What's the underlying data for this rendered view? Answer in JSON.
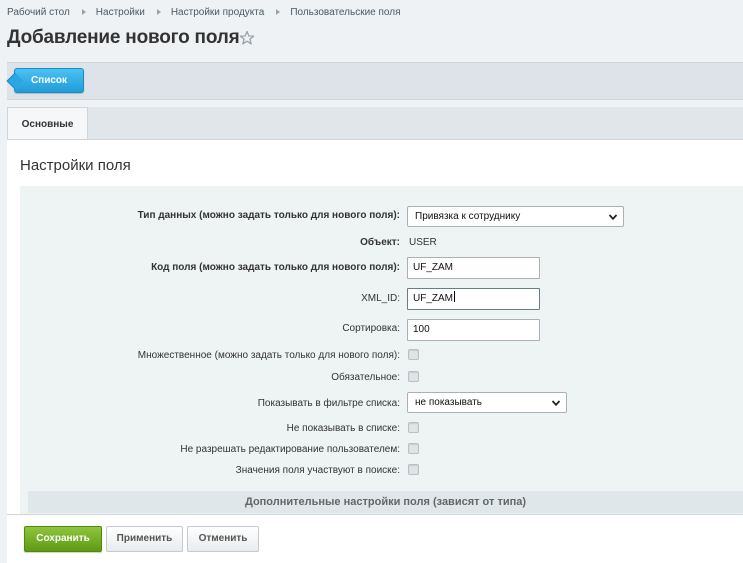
{
  "breadcrumbs": [
    "Рабочий стол",
    "Настройки",
    "Настройки продукта",
    "Пользовательские поля"
  ],
  "title": "Добавление нового поля",
  "toolbar": {
    "list_button": "Список"
  },
  "tabs": [
    {
      "label": "Основные",
      "active": true
    }
  ],
  "section_title": "Настройки поля",
  "form": {
    "data_type": {
      "label": "Тип данных (можно задать только для нового поля):",
      "value": "Привязка к сотруднику"
    },
    "object": {
      "label": "Объект:",
      "value": "USER"
    },
    "field_code": {
      "label": "Код поля (можно задать только для нового поля):",
      "value": "UF_ZAM"
    },
    "xml_id": {
      "label": "XML_ID:",
      "value": "UF_ZAM"
    },
    "sort": {
      "label": "Сортировка:",
      "value": "100"
    },
    "multiple": {
      "label": "Множественное (можно задать только для нового поля):",
      "checked": false
    },
    "required": {
      "label": "Обязательное:",
      "checked": false
    },
    "show_filter": {
      "label": "Показывать в фильтре списка:",
      "value": "не показывать"
    },
    "hide_in_list": {
      "label": "Не показывать в списке:",
      "checked": false
    },
    "no_user_edit": {
      "label": "Не разрешать редактирование пользователем:",
      "checked": false
    },
    "searchable": {
      "label": "Значения поля участвуют в поиске:",
      "checked": false
    }
  },
  "extra_settings_header": "Дополнительные настройки поля (зависят от типа)",
  "footer": {
    "save": "Сохранить",
    "apply": "Применить",
    "cancel": "Отменить"
  },
  "colors": {
    "accent_blue": "#2aa7e0",
    "save_green": "#6ca822"
  },
  "icons": {
    "favorite": "star-icon",
    "dropdown": "chevron-down-icon"
  }
}
